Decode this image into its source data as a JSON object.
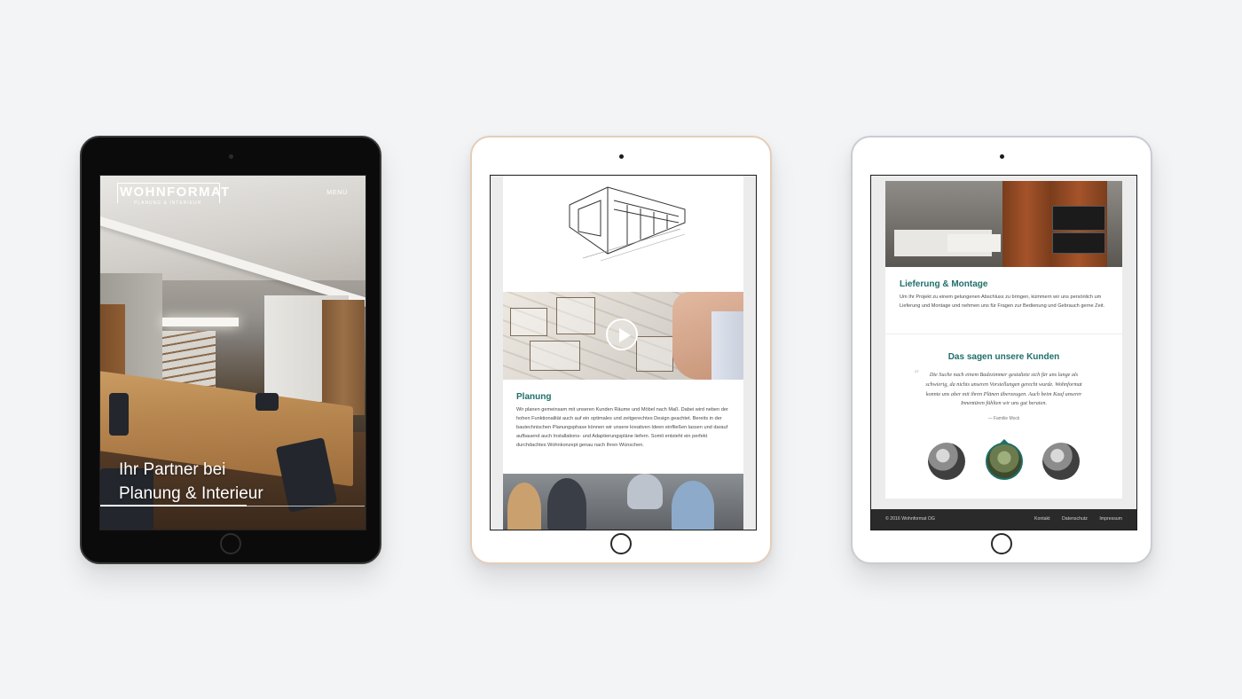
{
  "devices": [
    {
      "frame": "space-gray",
      "site": {
        "logo": {
          "name": "WOHNFORMAT",
          "tagline": "PLANUNG & INTERIEUR"
        },
        "menu_label": "MENÜ",
        "hero_title_line1": "Ihr Partner bei",
        "hero_title_line2": "Planung & Interieur"
      }
    },
    {
      "frame": "gold",
      "site": {
        "video_button_icon": "play-icon",
        "planung": {
          "title": "Planung",
          "text": "Wir planen gemeinsam mit unseren Kunden Räume und Möbel nach Maß. Dabei wird neben der hohen Funktionalität auch auf ein optimales und zeitgerechtes Design geachtet. Bereits in der bautechnischen Planungsphase können wir unsere kreativen Ideen einfließen lassen und darauf aufbauend auch Installations- und Adaptierungspläne liefern. Somit entsteht ein perfekt durchdachtes Wohnkonzept genau nach Ihren Wünschen."
        }
      }
    },
    {
      "frame": "silver",
      "site": {
        "lieferung": {
          "title": "Lieferung & Montage",
          "text": "Um Ihr Projekt zu einem gelungenen Abschluss zu bringen, kümmern wir uns persönlich um Lieferung und Montage und nehmen uns für Fragen zur Bedienung und Gebrauch gerne Zeit."
        },
        "testimonials": {
          "title": "Das sagen unsere Kunden",
          "quote": "Die Suche nach einem Badezimmer gestaltete sich für uns lange als schwierig, da nichts unseren Vorstellungen gerecht wurde. Wohnformat konnte uns aber mit ihren Plänen überzeugen. Auch beim Kauf unserer Innentüren fühlten wir uns gut beraten.",
          "author": "— Familie Mock",
          "selected_avatar": 2
        },
        "footer": {
          "copyright": "© 2016 Wohnformat OG",
          "links": [
            "Kontakt",
            "Datenschutz",
            "Impressum"
          ]
        }
      }
    }
  ],
  "colors": {
    "page_bg": "#f3f4f6",
    "accent_teal": "#1f6f6a",
    "footer_bg": "#2a2a2a"
  }
}
